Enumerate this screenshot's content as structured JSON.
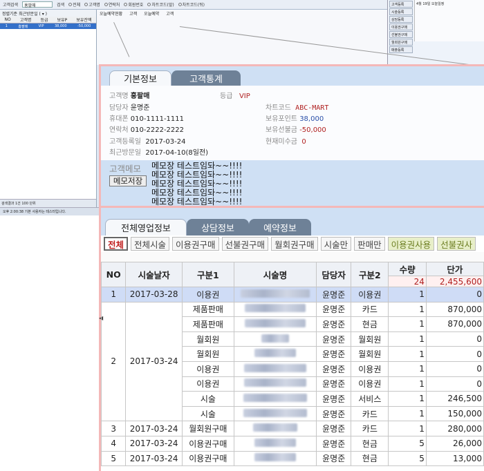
{
  "bg": {
    "search_label": "고객검색",
    "search_value": "홍팔매",
    "search_btn": "검색",
    "radios": [
      "전체",
      "고객명",
      "연락처",
      "회원번호",
      "차트코드(앞)",
      "차트코드(뒤)"
    ],
    "left_filter": "정렬기준 최근방문일 ( ▾ )",
    "left_cols": [
      "NO",
      "고객명",
      "등급",
      "보유P",
      "보유잔액"
    ],
    "left_row": [
      "1",
      "홍팔매",
      "VIP",
      "38,000",
      "-50,000"
    ],
    "left_footer": "검색결과 1건   100 단위",
    "mid_header": [
      "오늘예약현황",
      "고객",
      "오늘예약",
      "고객"
    ],
    "right_buttons": [
      "고객등록",
      "시술등록",
      "상담등록",
      "이용권구매",
      "선불권구매",
      "월회원구매",
      "매출등록"
    ],
    "cal_title": "4월 19일 오늘일정",
    "status": "오후 2:00:38    기본 사용자는 테스터입니다."
  },
  "panel1": {
    "tabs": [
      "기본정보",
      "고객통계"
    ],
    "fields": {
      "name_lbl": "고객명",
      "name_val": "홍팔매",
      "grade_lbl": "등급",
      "grade_val": "VIP",
      "staff_lbl": "담당자",
      "staff_val": "윤명준",
      "chart_lbl": "차트코드",
      "chart_val": "ABC-MART",
      "mobile_lbl": "휴대폰",
      "mobile_val": "010-1111-1111",
      "point_lbl": "보유포인트",
      "point_val": "38,000",
      "phone_lbl": "연락처",
      "phone_val": "010-2222-2222",
      "prepaid_lbl": "보유선불금",
      "prepaid_val": "-50,000",
      "reg_lbl": "고객등록일",
      "reg_val": "2017-03-24",
      "unpaid_lbl": "현재미수금",
      "unpaid_val": "0",
      "visit_lbl": "최근방문일",
      "visit_val": "2017-04-10(8일전)"
    },
    "memo_lbl": "고객메모",
    "memo_lines": [
      "메모장 테스트임돠~~!!!!",
      "메모장 테스트임돠~~!!!!",
      "메모장 테스트임돠~~!!!!",
      "메모장 테스트임돠~~!!!!",
      "메모장 테스트임돠~~!!!!"
    ],
    "memo_save": "메모저장"
  },
  "panel2": {
    "tabs": [
      "전체영업정보",
      "상담정보",
      "예약정보"
    ],
    "subtabs": [
      "전체",
      "전체시술",
      "이용권구매",
      "선불권구매",
      "월회권구매",
      "시술만",
      "판매만",
      "이용권사용",
      "선불권사"
    ],
    "columns": [
      "NO",
      "시술날자",
      "구분1",
      "시술명",
      "담당자",
      "구분2",
      "수량",
      "단가"
    ],
    "totals": {
      "qty": "24",
      "price": "2,455,600"
    },
    "rows": [
      {
        "no": "1",
        "date": "2017-03-28",
        "g1": "이용권",
        "staff": "윤명준",
        "g2": "이용권",
        "qty": "1",
        "price": "0"
      },
      {
        "no": "",
        "date": "",
        "g1": "제품판매",
        "staff": "윤명준",
        "g2": "카드",
        "qty": "1",
        "price": "870,000"
      },
      {
        "no": "",
        "date": "",
        "g1": "제품판매",
        "staff": "윤명준",
        "g2": "현금",
        "qty": "1",
        "price": "870,000"
      },
      {
        "no": "",
        "date": "",
        "g1": "월회원",
        "staff": "윤명준",
        "g2": "월회원",
        "qty": "1",
        "price": "0"
      },
      {
        "no": "2",
        "date": "2017-03-24",
        "g1": "월회원",
        "staff": "윤명준",
        "g2": "월회원",
        "qty": "1",
        "price": "0"
      },
      {
        "no": "",
        "date": "",
        "g1": "이용권",
        "staff": "윤명준",
        "g2": "이용권",
        "qty": "1",
        "price": "0"
      },
      {
        "no": "",
        "date": "",
        "g1": "이용권",
        "staff": "윤명준",
        "g2": "이용권",
        "qty": "1",
        "price": "0"
      },
      {
        "no": "",
        "date": "",
        "g1": "시술",
        "staff": "윤명준",
        "g2": "서비스",
        "qty": "1",
        "price": "246,500"
      },
      {
        "no": "",
        "date": "",
        "g1": "시술",
        "staff": "윤명준",
        "g2": "카드",
        "qty": "1",
        "price": "150,000"
      },
      {
        "no": "3",
        "date": "2017-03-24",
        "g1": "월회원구매",
        "staff": "윤명준",
        "g2": "카드",
        "qty": "1",
        "price": "280,000"
      },
      {
        "no": "4",
        "date": "2017-03-24",
        "g1": "이용권구매",
        "staff": "윤명준",
        "g2": "현금",
        "qty": "5",
        "price": "26,000"
      },
      {
        "no": "5",
        "date": "2017-03-24",
        "g1": "이용권구매",
        "staff": "윤명준",
        "g2": "현금",
        "qty": "5",
        "price": "13,000"
      }
    ]
  }
}
